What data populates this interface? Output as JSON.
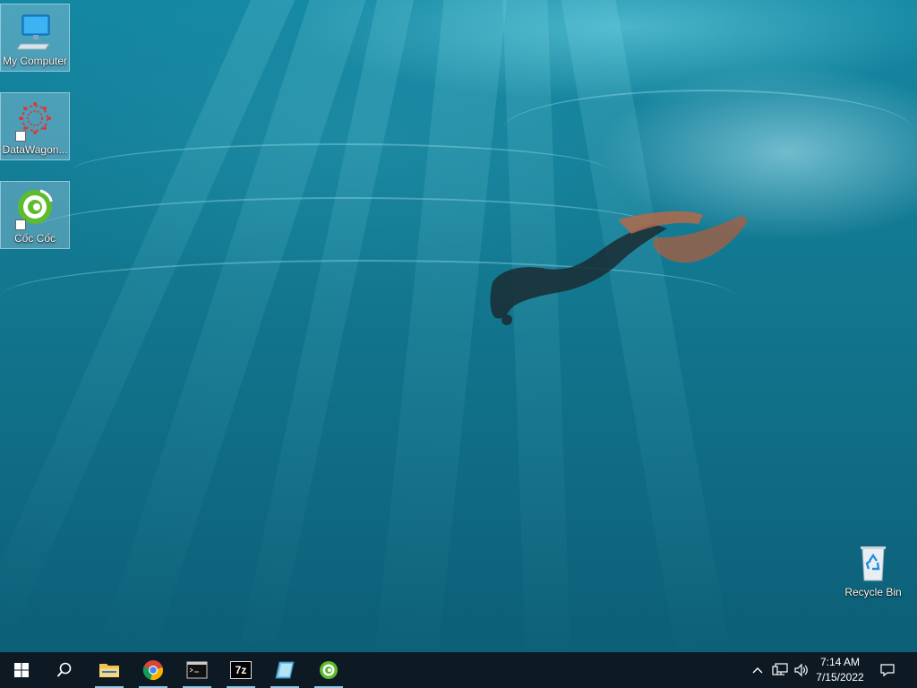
{
  "desktop": {
    "icons": [
      {
        "label": "My Computer",
        "icon": "computer-icon"
      },
      {
        "label": "DataWagon...",
        "icon": "datawagon-icon"
      },
      {
        "label": "Cốc Cốc",
        "icon": "coccoc-icon"
      }
    ],
    "recycle_bin": {
      "label": "Recycle Bin",
      "icon": "recycle-bin-icon"
    }
  },
  "taskbar": {
    "start": "start-icon",
    "search": "search-icon",
    "pinned": [
      {
        "name": "File Explorer",
        "icon": "folder-icon"
      },
      {
        "name": "Google Chrome",
        "icon": "chrome-icon"
      },
      {
        "name": "Command Prompt",
        "icon": "cmd-icon"
      },
      {
        "name": "7-Zip",
        "icon": "7zip-icon",
        "glyph": "7z"
      },
      {
        "name": "Notepad",
        "icon": "notepad-icon"
      },
      {
        "name": "Cốc Cốc",
        "icon": "coccoc-icon"
      }
    ],
    "tray": {
      "chevron": "^",
      "time": "7:14 AM",
      "date": "7/15/2022"
    }
  },
  "colors": {
    "taskbar": "#0d1a24",
    "accent": "#8fc8e8",
    "water": "#12778f"
  }
}
